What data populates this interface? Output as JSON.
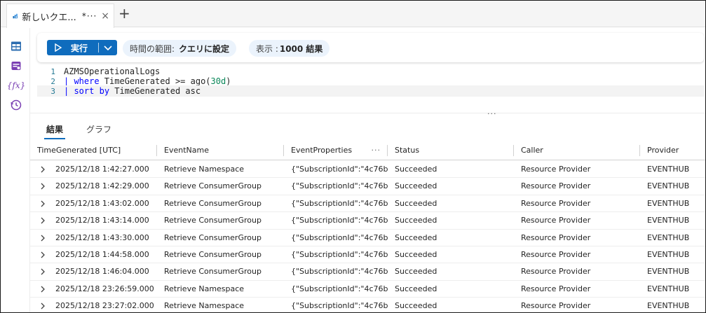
{
  "tab": {
    "title": "新しいクエ...",
    "dirty_marker": "*···",
    "close_glyph": "×",
    "add_glyph": "+"
  },
  "rail": {
    "icons": [
      "tables-icon",
      "queries-icon",
      "functions-icon",
      "history-icon"
    ],
    "functions_glyph": "{fx}"
  },
  "toolbar": {
    "run_label": "実行",
    "time_range_key": "時間の範囲:",
    "time_range_value": "クエリに設定",
    "limit_key": "表示 :",
    "limit_value": "1000 結果"
  },
  "editor": {
    "lines": [
      {
        "n": "1",
        "parts": [
          {
            "t": "AZMSOperationalLogs",
            "c": "plain"
          }
        ]
      },
      {
        "n": "2",
        "parts": [
          {
            "t": "| ",
            "c": "pipe"
          },
          {
            "t": "where",
            "c": "kw"
          },
          {
            "t": " TimeGenerated >= ago(",
            "c": "plain"
          },
          {
            "t": "30d",
            "c": "num"
          },
          {
            "t": ")",
            "c": "plain"
          }
        ]
      },
      {
        "n": "3",
        "parts": [
          {
            "t": "| ",
            "c": "pipe"
          },
          {
            "t": "sort",
            "c": "kw"
          },
          {
            "t": " ",
            "c": "plain"
          },
          {
            "t": "by",
            "c": "kw"
          },
          {
            "t": " TimeGenerated asc",
            "c": "plain"
          }
        ]
      }
    ],
    "splitter_glyph": "···"
  },
  "results": {
    "tabs": [
      "結果",
      "グラフ"
    ],
    "active_tab": 0,
    "columns": [
      "TimeGenerated [UTC]",
      "EventName",
      "EventProperties",
      "Status",
      "Caller",
      "Provider"
    ],
    "column_menu_glyph": "···",
    "rows": [
      [
        "2025/12/18 1:42:27.000",
        "Retrieve Namespace",
        "{\"SubscriptionId\":\"4c76b...",
        "Succeeded",
        "Resource Provider",
        "EVENTHUB"
      ],
      [
        "2025/12/18 1:42:29.000",
        "Retrieve ConsumerGroup",
        "{\"SubscriptionId\":\"4c76b...",
        "Succeeded",
        "Resource Provider",
        "EVENTHUB"
      ],
      [
        "2025/12/18 1:43:02.000",
        "Retrieve ConsumerGroup",
        "{\"SubscriptionId\":\"4c76b...",
        "Succeeded",
        "Resource Provider",
        "EVENTHUB"
      ],
      [
        "2025/12/18 1:43:14.000",
        "Retrieve ConsumerGroup",
        "{\"SubscriptionId\":\"4c76b...",
        "Succeeded",
        "Resource Provider",
        "EVENTHUB"
      ],
      [
        "2025/12/18 1:43:30.000",
        "Retrieve ConsumerGroup",
        "{\"SubscriptionId\":\"4c76b...",
        "Succeeded",
        "Resource Provider",
        "EVENTHUB"
      ],
      [
        "2025/12/18 1:44:58.000",
        "Retrieve ConsumerGroup",
        "{\"SubscriptionId\":\"4c76b...",
        "Succeeded",
        "Resource Provider",
        "EVENTHUB"
      ],
      [
        "2025/12/18 1:46:04.000",
        "Retrieve ConsumerGroup",
        "{\"SubscriptionId\":\"4c76b...",
        "Succeeded",
        "Resource Provider",
        "EVENTHUB"
      ],
      [
        "2025/12/18 23:26:59.000",
        "Retrieve Namespace",
        "{\"SubscriptionId\":\"4c76b...",
        "Succeeded",
        "Resource Provider",
        "EVENTHUB"
      ],
      [
        "2025/12/18 23:27:02.000",
        "Retrieve Namespace",
        "{\"SubscriptionId\":\"4c76b...",
        "Succeeded",
        "Resource Provider",
        "EVENTHUB"
      ]
    ]
  },
  "colors": {
    "accent": "#0f6cbd",
    "pill_bg": "#ebf3fc",
    "rail_icon": "#7a3fb3",
    "rail_icon_table": "#2b6cb0"
  }
}
